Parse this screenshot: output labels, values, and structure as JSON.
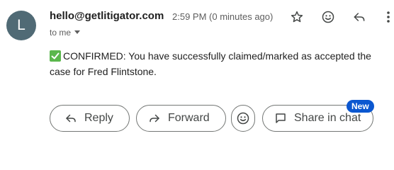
{
  "header": {
    "avatar_letter": "L",
    "sender": "hello@getlitigator.com",
    "time": "2:59 PM (0 minutes ago)",
    "recipient": "to me"
  },
  "message": {
    "body": "CONFIRMED: You have successfully claimed/marked as accepted the case for Fred Flintstone."
  },
  "actions": {
    "reply_label": "Reply",
    "forward_label": "Forward",
    "share_label": "Share in chat",
    "new_badge": "New"
  },
  "icons": {
    "star": "star-icon",
    "emoji": "emoji-icon",
    "reply": "reply-icon",
    "more": "more-vert-icon",
    "forward": "forward-icon",
    "chat": "chat-icon",
    "check": "check-mark-icon"
  },
  "colors": {
    "avatar_bg": "#506a75",
    "badge_bg": "#0b57d0",
    "check_bg": "#5bb74d"
  }
}
